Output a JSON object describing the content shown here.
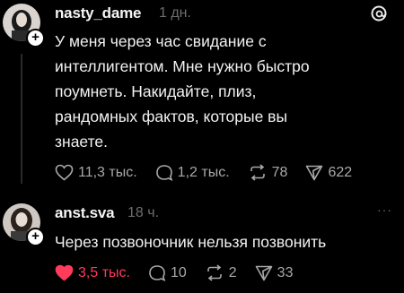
{
  "posts": [
    {
      "username": "nasty_dame",
      "time": "1 дн.",
      "text": "У меня через час свидание с\nинтеллигентом. Мне нужно быстро\nпоумнеть. Накидайте, плиз,\nрандомных фактов, которые вы\nзнаете.",
      "likes": "11,3 тыс.",
      "replies": "1,2 тыс.",
      "reposts": "78",
      "shares": "622",
      "liked": false
    },
    {
      "username": "anst.sva",
      "time": "18 ч.",
      "text": "Через позвоночник нельзя позвонить",
      "likes": "3,5 тыс.",
      "replies": "10",
      "reposts": "2",
      "shares": "33",
      "liked": true
    }
  ],
  "colors": {
    "background": "#000000",
    "liked": "#ff3b5c",
    "muted": "#a8a8a8"
  },
  "icons": [
    "threads-logo-icon",
    "plus-icon",
    "heart-icon",
    "comment-icon",
    "repost-icon",
    "share-icon",
    "more-icon"
  ]
}
